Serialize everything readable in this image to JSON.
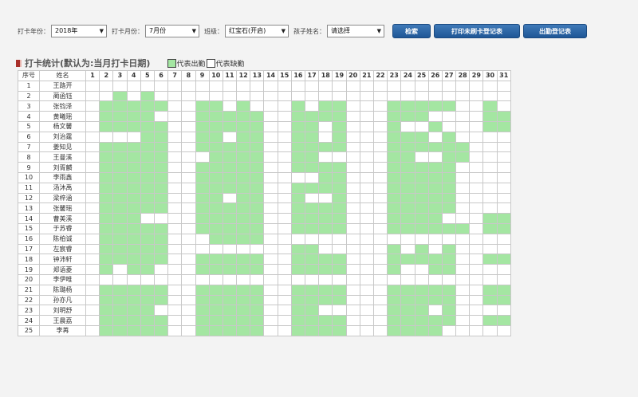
{
  "filters": {
    "year_label": "打卡年份：",
    "year_value": "2018年",
    "month_label": "打卡月份：",
    "month_value": "7月份",
    "class_label": "班级：",
    "class_value": "红宝石(开启)",
    "child_label": "孩子姓名：",
    "child_value": "请选择"
  },
  "buttons": {
    "search": "检索",
    "print_unswiped": "打印未刷卡登记表",
    "attendance_register": "出勤登记表"
  },
  "section": {
    "title": "打卡统计(默认为:当月打卡日期)",
    "legend_present": "代表出勤",
    "legend_absent": "代表缺勤"
  },
  "colors": {
    "present": "#a4e6a2",
    "absent": "#ffffff",
    "button": "#2b65a6",
    "title_mark": "#a9302a"
  },
  "table": {
    "col_seq": "序号",
    "col_name": "姓名",
    "days": [
      "1",
      "2",
      "3",
      "4",
      "5",
      "6",
      "7",
      "8",
      "9",
      "10",
      "11",
      "12",
      "13",
      "14",
      "15",
      "16",
      "17",
      "18",
      "19",
      "20",
      "21",
      "22",
      "23",
      "24",
      "25",
      "26",
      "27",
      "28",
      "29",
      "30",
      "31"
    ],
    "rows": [
      {
        "seq": "1",
        "name": "王路开",
        "att": "0000000000000000000000000000000"
      },
      {
        "seq": "2",
        "name": "蔺函钰",
        "att": "0010100000000000000000000000000"
      },
      {
        "seq": "3",
        "name": "张钧泽",
        "att": "0111110011010001011000111110010"
      },
      {
        "seq": "4",
        "name": "黄曦瑶",
        "att": "0111100011111001111000111000011"
      },
      {
        "seq": "5",
        "name": "杨文馨",
        "att": "0111110011111001101000100100011"
      },
      {
        "seq": "6",
        "name": "刘治霆",
        "att": "0000110011011001101000111010000"
      },
      {
        "seq": "7",
        "name": "姜知见",
        "att": "0111110011111001111000111111000"
      },
      {
        "seq": "8",
        "name": "王曼溪",
        "att": "0111110001111001100000110011000"
      },
      {
        "seq": "9",
        "name": "刘胥麟",
        "att": "0111110011111001111000111110000"
      },
      {
        "seq": "10",
        "name": "李雨鑫",
        "att": "0111110011111000011000111110000"
      },
      {
        "seq": "11",
        "name": "汤沐禹",
        "att": "0111110011111001111000111110000"
      },
      {
        "seq": "12",
        "name": "梁梓涵",
        "att": "0111110011011001001000111110000"
      },
      {
        "seq": "13",
        "name": "张馨瑶",
        "att": "0111110011111001111000111110000"
      },
      {
        "seq": "14",
        "name": "曹美溪",
        "att": "0111000011111001111000111100011"
      },
      {
        "seq": "15",
        "name": "于苏睿",
        "att": "0111110011111001111000111111011"
      },
      {
        "seq": "16",
        "name": "陈柏诚",
        "att": "0111110001111000000000000000000"
      },
      {
        "seq": "17",
        "name": "左宸睿",
        "att": "0111110000000001100000101010000"
      },
      {
        "seq": "18",
        "name": "钟沛轩",
        "att": "0111110011111001111000111110011"
      },
      {
        "seq": "19",
        "name": "郑语菱",
        "att": "0101100011111001111000100110000"
      },
      {
        "seq": "20",
        "name": "李伊唯",
        "att": "0000000000000000000000000000000"
      },
      {
        "seq": "21",
        "name": "陈璐杨",
        "att": "0111110011111001111000111110011"
      },
      {
        "seq": "22",
        "name": "孙亦凡",
        "att": "0111110011111001111000111110011"
      },
      {
        "seq": "23",
        "name": "刘明舒",
        "att": "0111100011111001100000111010000"
      },
      {
        "seq": "24",
        "name": "王晨荔",
        "att": "0111110011111001111000111110011"
      },
      {
        "seq": "25",
        "name": "李苒",
        "att": "0111110011111001111000111100000"
      }
    ]
  }
}
